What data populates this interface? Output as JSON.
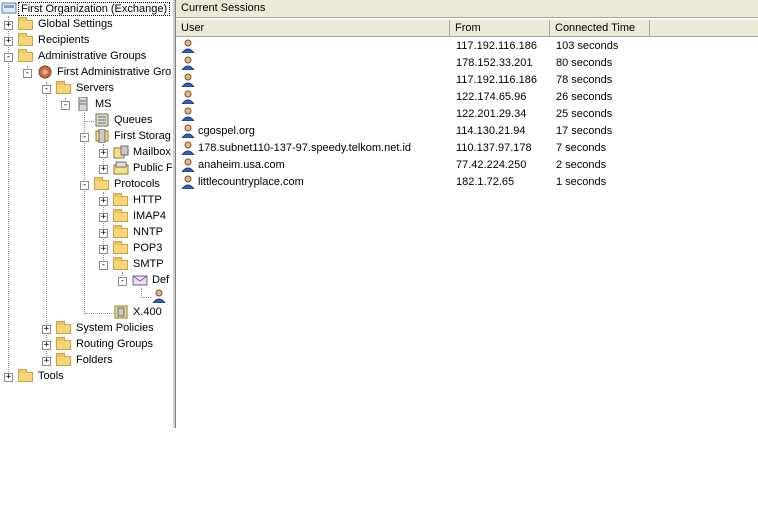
{
  "tree": {
    "root": "First Organization (Exchange)",
    "global_settings": "Global Settings",
    "recipients": "Recipients",
    "administrative_groups": "Administrative Groups",
    "first_admin_group": "First Administrative Gro",
    "servers": "Servers",
    "ms": "MS",
    "queues": "Queues",
    "first_storage": "First Storag",
    "mailbox": "Mailbox",
    "public": "Public F",
    "protocols": "Protocols",
    "http": "HTTP",
    "imap4": "IMAP4",
    "nntp": "NNTP",
    "pop3": "POP3",
    "smtp": "SMTP",
    "default_smtp": "Def",
    "x400": "X.400",
    "system_policies": "System Policies",
    "routing_groups": "Routing Groups",
    "folders": "Folders",
    "tools": "Tools"
  },
  "pane": {
    "title": "Current Sessions"
  },
  "columns": {
    "user": "User",
    "from": "From",
    "connected": "Connected Time"
  },
  "sessions": [
    {
      "user": "",
      "from": "117.192.116.186",
      "connected": "103 seconds"
    },
    {
      "user": "",
      "from": "178.152.33.201",
      "connected": "80 seconds"
    },
    {
      "user": "",
      "from": "117.192.116.186",
      "connected": "78 seconds"
    },
    {
      "user": "",
      "from": "122.174.65.96",
      "connected": "26 seconds"
    },
    {
      "user": "",
      "from": "122.201.29.34",
      "connected": "25 seconds"
    },
    {
      "user": "cgospel.org",
      "from": "114.130.21.94",
      "connected": "17 seconds"
    },
    {
      "user": "178.subnet110-137-97.speedy.telkom.net.id",
      "from": "110.137.97.178",
      "connected": "7 seconds"
    },
    {
      "user": "anaheim.usa.com",
      "from": "77.42.224.250",
      "connected": "2 seconds"
    },
    {
      "user": "littlecountryplace.com",
      "from": "182.1.72.65",
      "connected": "1 seconds"
    }
  ],
  "colors": {
    "folder": "#f5d77a",
    "header_bg": "#ece9d8",
    "selection_border": "#000000",
    "user_icon": "#2f62c9"
  },
  "icons": {
    "folder": "folder-icon",
    "server": "server-icon",
    "queue": "queue-icon",
    "storage": "storage-group-icon",
    "user": "user-session-icon",
    "org": "exchange-org-icon",
    "admin_group": "admin-group-icon"
  }
}
